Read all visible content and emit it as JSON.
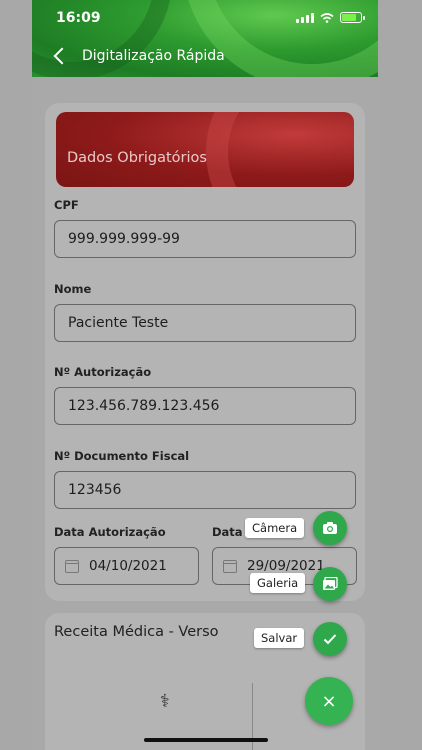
{
  "status_bar": {
    "time": "16:09"
  },
  "header": {
    "title": "Digitalização Rápida"
  },
  "section": {
    "title": "Dados Obrigatórios",
    "cpf": {
      "label": "CPF",
      "value": "999.999.999-99"
    },
    "nome": {
      "label": "Nome",
      "value": "Paciente Teste"
    },
    "autorizacao": {
      "label": "Nº Autorização",
      "value": "123.456.789.123.456"
    },
    "documento": {
      "label": "Nº Documento Fiscal",
      "value": "123456"
    },
    "data_autorizacao": {
      "label": "Data Autorização",
      "value": "04/10/2021"
    },
    "data_emissao": {
      "label": "Data I",
      "value": "29/09/2021"
    }
  },
  "section2": {
    "title": "Receita Médica - Verso"
  },
  "fab_menu": {
    "camera": "Câmera",
    "galeria": "Galeria",
    "salvar": "Salvar",
    "close_icon": "×"
  },
  "colors": {
    "green": "#2fa84b",
    "banner_red": "#8e1a1a"
  }
}
